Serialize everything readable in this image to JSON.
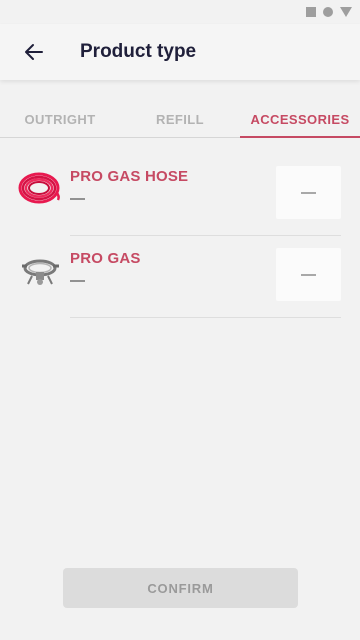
{
  "header": {
    "title": "Product type"
  },
  "tabs": [
    {
      "label": "OUTRIGHT",
      "active": false
    },
    {
      "label": "REFILL",
      "active": false
    },
    {
      "label": "ACCESSORIES",
      "active": true
    }
  ],
  "products": [
    {
      "name": "PRO GAS HOSE",
      "price": "—",
      "quantity": "—",
      "image": "red-hose-coil"
    },
    {
      "name": "PRO GAS",
      "price": "—",
      "quantity": "—",
      "image": "gas-regulator"
    }
  ],
  "footer": {
    "confirm_label": "CONFIRM"
  },
  "colors": {
    "accent": "#c64a63",
    "title": "#1f1f3a",
    "inactive_tab": "#b3b3b3",
    "button_disabled": "#dcdcdc"
  },
  "icons": {
    "back": "arrow-left-icon"
  }
}
